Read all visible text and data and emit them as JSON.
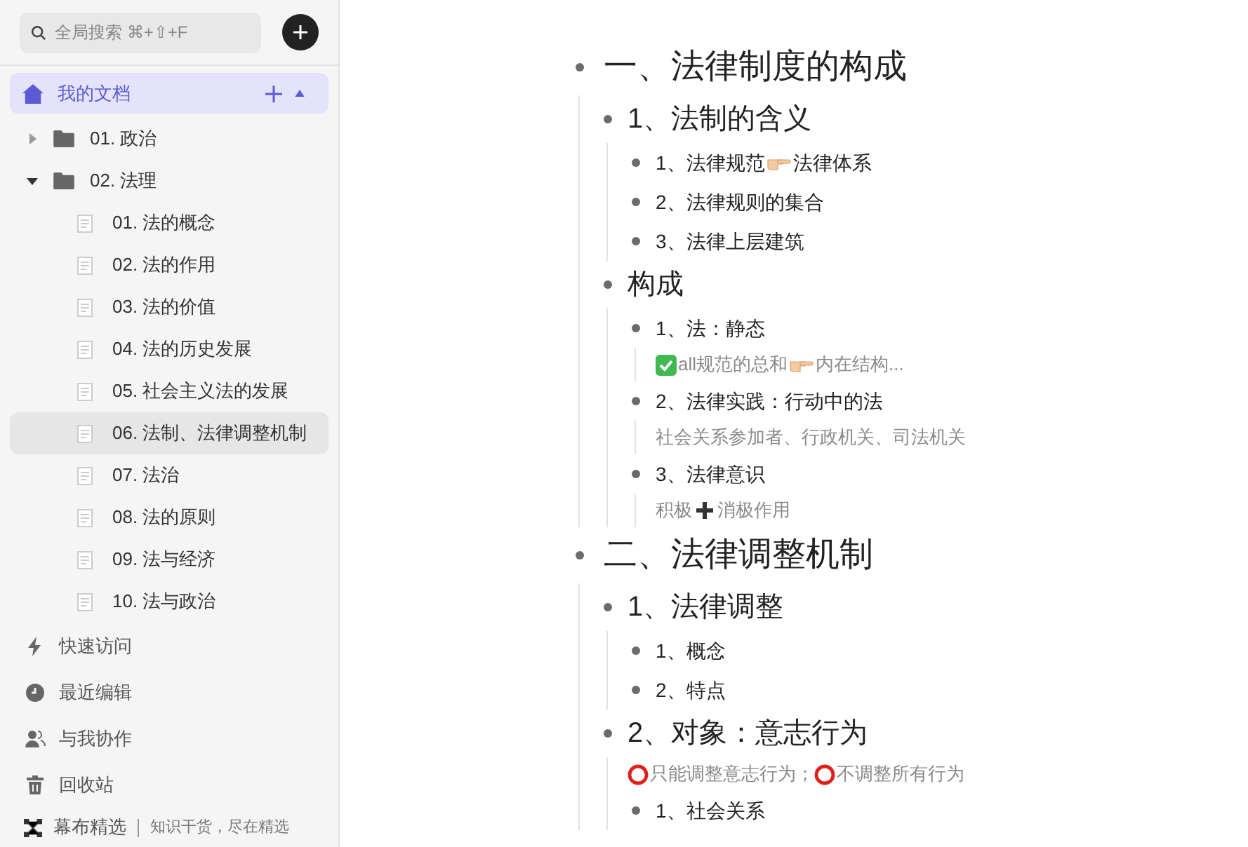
{
  "sidebar": {
    "search": {
      "placeholder": "全局搜索 ⌘+⇧+F"
    },
    "my_docs": {
      "label": "我的文档",
      "selected": true,
      "expanded": true
    },
    "tree": [
      {
        "kind": "folder",
        "label": "01. 政治",
        "expanded": false,
        "selected": false
      },
      {
        "kind": "folder",
        "label": "02. 法理",
        "expanded": true,
        "selected": false,
        "children": [
          {
            "kind": "doc",
            "label": "01. 法的概念",
            "selected": false
          },
          {
            "kind": "doc",
            "label": "02. 法的作用",
            "selected": false
          },
          {
            "kind": "doc",
            "label": "03. 法的价值",
            "selected": false
          },
          {
            "kind": "doc",
            "label": "04. 法的历史发展",
            "selected": false
          },
          {
            "kind": "doc",
            "label": "05. 社会主义法的发展",
            "selected": false
          },
          {
            "kind": "doc",
            "label": "06. 法制、法律调整机制",
            "selected": true
          },
          {
            "kind": "doc",
            "label": "07. 法治",
            "selected": false
          },
          {
            "kind": "doc",
            "label": "08. 法的原则",
            "selected": false
          },
          {
            "kind": "doc",
            "label": "09. 法与经济",
            "selected": false
          },
          {
            "kind": "doc",
            "label": "10. 法与政治",
            "selected": false
          }
        ]
      }
    ],
    "nav": [
      {
        "kind": "quick",
        "label": "快速访问"
      },
      {
        "kind": "recent",
        "label": "最近编辑"
      },
      {
        "kind": "shared",
        "label": "与我协作"
      },
      {
        "kind": "trash",
        "label": "回收站"
      }
    ],
    "footer": {
      "title": "幕布精选",
      "tagline": "知识干货，尽在精选"
    }
  },
  "outline": [
    {
      "title": [
        {
          "kind": "text",
          "text": "一、法律制度的构成"
        }
      ],
      "children": [
        {
          "title": [
            {
              "kind": "text",
              "text": "1、法制的含义"
            }
          ],
          "children": [
            {
              "title": [
                {
                  "kind": "text",
                  "text": "1、法律规范"
                },
                {
                  "kind": "point"
                },
                {
                  "kind": "text",
                  "text": "法律体系"
                }
              ]
            },
            {
              "title": [
                {
                  "kind": "text",
                  "text": "2、法律规则的集合"
                }
              ]
            },
            {
              "title": [
                {
                  "kind": "text",
                  "text": "3、法律上层建筑"
                }
              ]
            }
          ]
        },
        {
          "title": [
            {
              "kind": "text",
              "text": "构成"
            }
          ],
          "children": [
            {
              "title": [
                {
                  "kind": "text",
                  "text": "1、法：静态"
                }
              ],
              "note": [
                {
                  "kind": "check"
                },
                {
                  "kind": "text",
                  "text": "all规范的总和"
                },
                {
                  "kind": "point"
                },
                {
                  "kind": "text",
                  "text": "内在结构..."
                }
              ]
            },
            {
              "title": [
                {
                  "kind": "text",
                  "text": "2、法律实践：行动中的法"
                }
              ],
              "note": [
                {
                  "kind": "text",
                  "text": "社会关系参加者、行政机关、司法机关"
                }
              ]
            },
            {
              "title": [
                {
                  "kind": "text",
                  "text": "3、法律意识"
                }
              ],
              "note": [
                {
                  "kind": "text",
                  "text": "积极"
                },
                {
                  "kind": "plus"
                },
                {
                  "kind": "text",
                  "text": "消极作用"
                }
              ]
            }
          ]
        }
      ]
    },
    {
      "title": [
        {
          "kind": "text",
          "text": "二、法律调整机制"
        }
      ],
      "children": [
        {
          "title": [
            {
              "kind": "text",
              "text": "1、法律调整"
            }
          ],
          "children": [
            {
              "title": [
                {
                  "kind": "text",
                  "text": "1、概念"
                }
              ]
            },
            {
              "title": [
                {
                  "kind": "text",
                  "text": "2、特点"
                }
              ]
            }
          ]
        },
        {
          "title": [
            {
              "kind": "text",
              "text": "2、对象：意志行为"
            }
          ],
          "note": [
            {
              "kind": "circle"
            },
            {
              "kind": "text",
              "text": "只能调整意志行为；"
            },
            {
              "kind": "circle"
            },
            {
              "kind": "text",
              "text": "不调整所有行为"
            }
          ],
          "children": [
            {
              "title": [
                {
                  "kind": "text",
                  "text": "1、社会关系"
                }
              ]
            }
          ]
        }
      ]
    }
  ]
}
